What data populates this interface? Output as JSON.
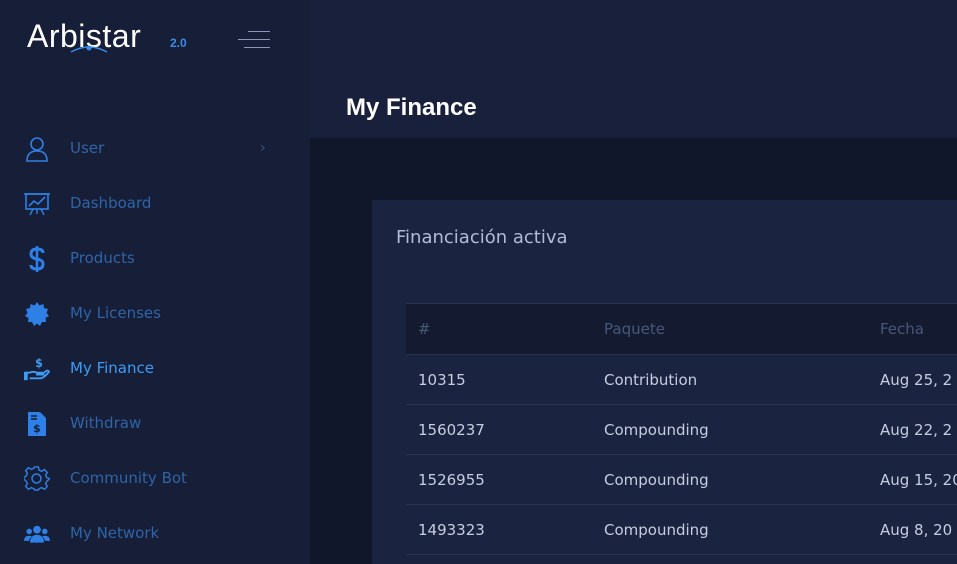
{
  "brand": {
    "name": "Arbistar",
    "version": "2.0",
    "accent": "#3a8ce6"
  },
  "sidebar": {
    "items": [
      {
        "label": "User",
        "icon": "user-icon",
        "has_submenu": true
      },
      {
        "label": "Dashboard",
        "icon": "presentation-chart-icon"
      },
      {
        "label": "Products",
        "icon": "dollar-icon"
      },
      {
        "label": "My Licenses",
        "icon": "badge-icon"
      },
      {
        "label": "My Finance",
        "icon": "hand-money-icon",
        "active": true
      },
      {
        "label": "Withdraw",
        "icon": "invoice-icon"
      },
      {
        "label": "Community Bot",
        "icon": "gear-icon"
      },
      {
        "label": "My Network",
        "icon": "users-icon"
      }
    ]
  },
  "page": {
    "title": "My Finance"
  },
  "card": {
    "title": "Financiación activa",
    "table": {
      "headers": [
        "#",
        "Paquete",
        "Fecha"
      ],
      "rows": [
        {
          "id": "10315",
          "package": "Contribution",
          "date": "Aug 25, 2"
        },
        {
          "id": "1560237",
          "package": "Compounding",
          "date": "Aug 22, 2"
        },
        {
          "id": "1526955",
          "package": "Compounding",
          "date": "Aug 15, 20"
        },
        {
          "id": "1493323",
          "package": "Compounding",
          "date": "Aug 8, 20"
        }
      ]
    }
  },
  "colors": {
    "sidebar_bg": "#161e38",
    "header_bg": "#19203b",
    "content_bg": "#10172a",
    "card_bg": "#1a2340",
    "nav_text": "#2f64a6",
    "nav_active": "#3f9cf5"
  }
}
